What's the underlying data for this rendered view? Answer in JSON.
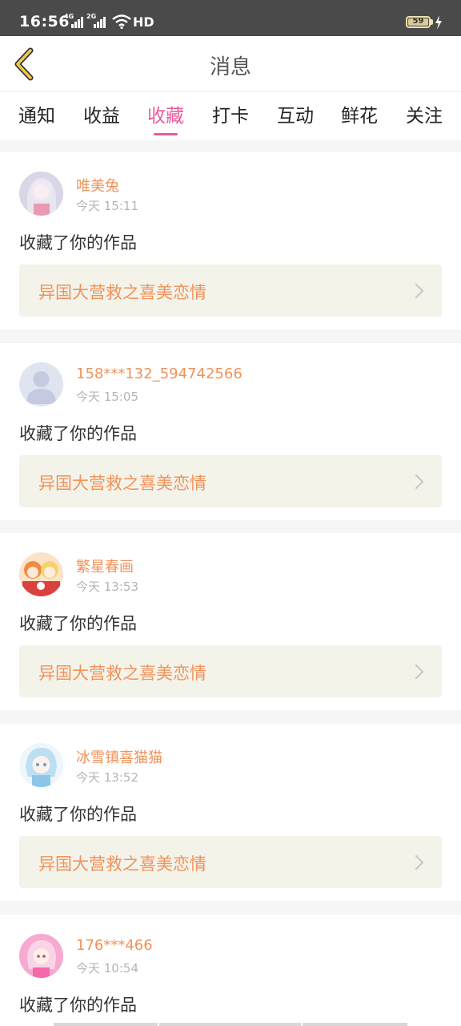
{
  "status_bar": {
    "time": "16:56",
    "signal_1": "4G",
    "signal_2": "2G",
    "network": "HD",
    "battery": "59"
  },
  "header": {
    "title": "消息",
    "back_icon": "chevron-left-icon"
  },
  "tabs": [
    {
      "label": "通知",
      "active": false
    },
    {
      "label": "收益",
      "active": false
    },
    {
      "label": "收藏",
      "active": true
    },
    {
      "label": "打卡",
      "active": false
    },
    {
      "label": "互动",
      "active": false
    },
    {
      "label": "鲜花",
      "active": false
    },
    {
      "label": "关注",
      "active": false
    }
  ],
  "feed": [
    {
      "user": "唯美兔",
      "time": "今天 15:11",
      "action": "收藏了你的作品",
      "work": "异国大营救之喜美恋情"
    },
    {
      "user": "158***132_594742566",
      "time": "今天 15:05",
      "action": "收藏了你的作品",
      "work": "异国大营救之喜美恋情"
    },
    {
      "user": "繁星春画",
      "time": "今天 13:53",
      "action": "收藏了你的作品",
      "work": "异国大营救之喜美恋情"
    },
    {
      "user": "冰雪镇喜猫猫",
      "time": "今天 13:52",
      "action": "收藏了你的作品",
      "work": "异国大营救之喜美恋情"
    },
    {
      "user": "176***466",
      "time": "今天 10:54",
      "action": "收藏了你的作品",
      "work": ""
    }
  ],
  "colors": {
    "accent_pink": "#e85b9b",
    "name_orange": "#f0925a",
    "back_yellow": "#f2c94c"
  }
}
